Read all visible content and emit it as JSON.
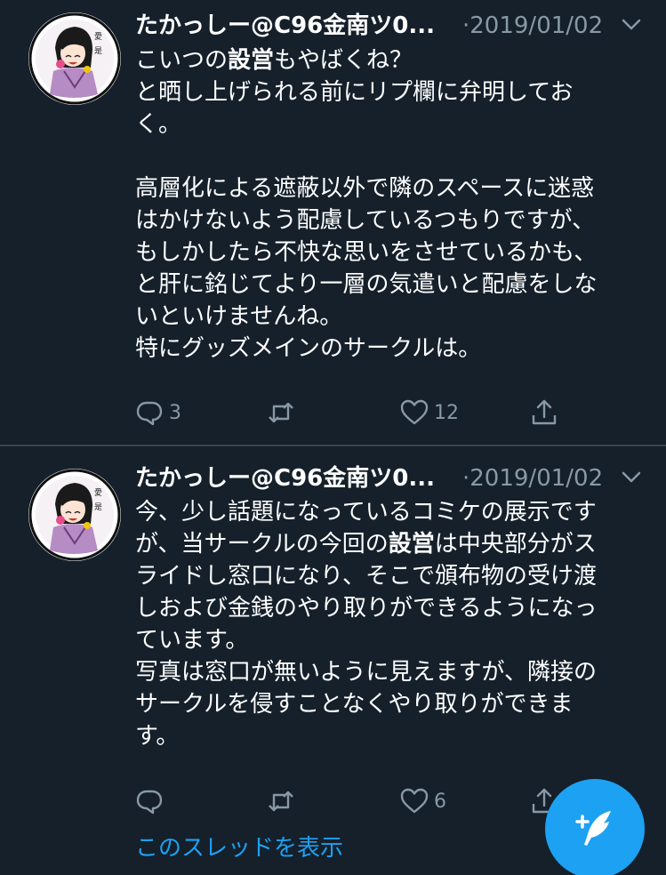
{
  "tweets": [
    {
      "author_name": "たかっしー@C96金南ツ0...",
      "separator_dot": "·",
      "date": "2019/01/02",
      "body_lines": [
        {
          "parts": [
            {
              "text": "こいつの",
              "bold": false
            },
            {
              "text": "設営",
              "bold": true
            },
            {
              "text": "もやばくね？",
              "bold": false
            }
          ]
        },
        {
          "parts": [
            {
              "text": "と晒し上げられる前にリプ欄に弁明してお",
              "bold": false
            }
          ]
        },
        {
          "parts": [
            {
              "text": "く。",
              "bold": false
            }
          ]
        },
        {
          "parts": [
            {
              "text": "",
              "bold": false
            }
          ]
        },
        {
          "parts": [
            {
              "text": "高層化による遮蔽以外で隣のスペースに迷惑",
              "bold": false
            }
          ]
        },
        {
          "parts": [
            {
              "text": "はかけないよう配慮しているつもりですが、",
              "bold": false
            }
          ]
        },
        {
          "parts": [
            {
              "text": "もしかしたら不快な思いをさせているかも、",
              "bold": false
            }
          ]
        },
        {
          "parts": [
            {
              "text": "と肝に銘じてより一層の気遣いと配慮をしな",
              "bold": false
            }
          ]
        },
        {
          "parts": [
            {
              "text": "いといけませんね。",
              "bold": false
            }
          ]
        },
        {
          "parts": [
            {
              "text": "特にグッズメインのサークルは。",
              "bold": false
            }
          ]
        }
      ],
      "reply_count": "3",
      "retweet_count": "",
      "like_count": "12"
    },
    {
      "author_name": "たかっしー@C96金南ツ0...",
      "separator_dot": "·",
      "date": "2019/01/02",
      "body_lines": [
        {
          "parts": [
            {
              "text": "今、少し話題になっているコミケの展示です",
              "bold": false
            }
          ]
        },
        {
          "parts": [
            {
              "text": "が、当サークルの今回の",
              "bold": false
            },
            {
              "text": "設営",
              "bold": true
            },
            {
              "text": "は中央部分がス",
              "bold": false
            }
          ]
        },
        {
          "parts": [
            {
              "text": "ライドし窓口になり、そこで頒布物の受け渡",
              "bold": false
            }
          ]
        },
        {
          "parts": [
            {
              "text": "しおよび金銭のやり取りができるようになっ",
              "bold": false
            }
          ]
        },
        {
          "parts": [
            {
              "text": "ています。",
              "bold": false
            }
          ]
        },
        {
          "parts": [
            {
              "text": "写真は窓口が無いように見えますが、隣接の",
              "bold": false
            }
          ]
        },
        {
          "parts": [
            {
              "text": "サークルを侵すことなくやり取りができま",
              "bold": false
            }
          ]
        },
        {
          "parts": [
            {
              "text": "す。",
              "bold": false
            }
          ]
        }
      ],
      "reply_count": "",
      "retweet_count": "",
      "like_count": "6"
    }
  ],
  "thread_link": "このスレッドを表示",
  "icons": {
    "reply": "reply-icon",
    "retweet": "retweet-icon",
    "like": "heart-icon",
    "share": "share-icon",
    "caret": "chevron-down-icon",
    "compose": "compose-tweet-icon"
  },
  "colors": {
    "background": "#15202b",
    "text_primary": "#ffffff",
    "text_secondary": "#8899a6",
    "accent": "#1da1f2",
    "divider": "#38444d"
  }
}
